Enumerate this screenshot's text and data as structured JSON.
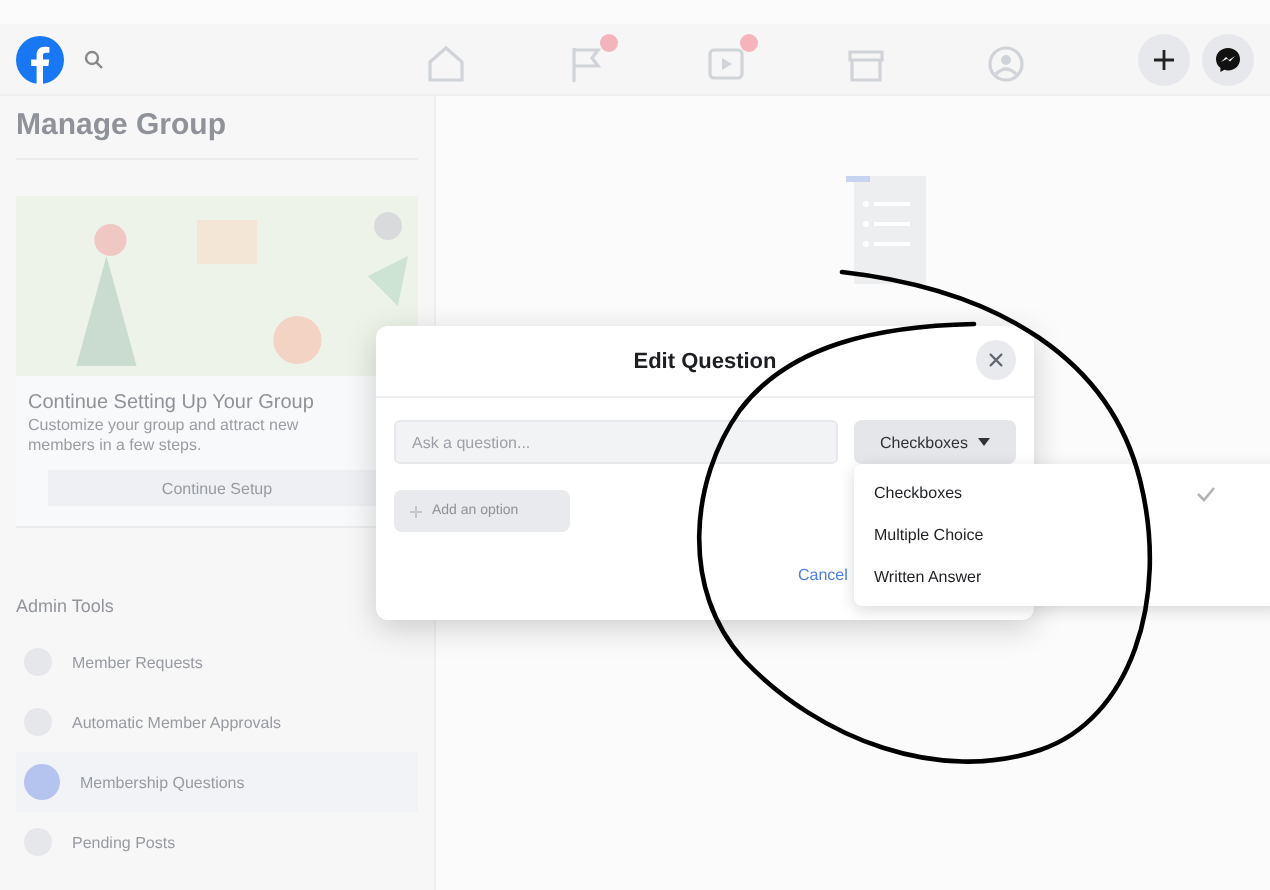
{
  "top_bar": {
    "nav_items": [
      {
        "kind": "home",
        "badge": false
      },
      {
        "kind": "flag",
        "badge": true
      },
      {
        "kind": "video",
        "badge": true
      },
      {
        "kind": "store",
        "badge": false
      },
      {
        "kind": "groups",
        "badge": false
      }
    ]
  },
  "sidebar": {
    "title": "Manage Group",
    "setup_card": {
      "title": "Continue Setting Up Your Group",
      "description": "Customize your group and attract new members in a few steps.",
      "button": "Continue Setup"
    },
    "section_title": "Admin Tools",
    "items": [
      {
        "label": "Member Requests",
        "selected": false
      },
      {
        "label": "Automatic Member Approvals",
        "selected": false
      },
      {
        "label": "Membership Questions",
        "selected": true
      },
      {
        "label": "Pending Posts",
        "selected": false
      }
    ]
  },
  "dialog": {
    "title": "Edit Question",
    "question": {
      "placeholder": "Ask a question..."
    },
    "type_select": "Checkboxes",
    "add_option": "Add an option",
    "cancel": "Cancel",
    "menu": [
      {
        "label": "Checkboxes",
        "selected": true
      },
      {
        "label": "Multiple Choice",
        "selected": false
      },
      {
        "label": "Written Answer",
        "selected": false
      }
    ]
  }
}
